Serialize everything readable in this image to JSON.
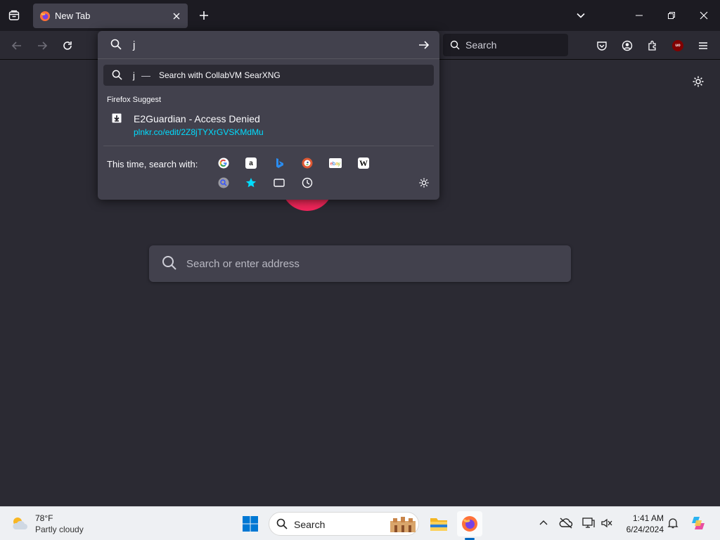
{
  "browser": {
    "tab": {
      "title": "New Tab"
    },
    "searchbar": {
      "placeholder": "Search"
    }
  },
  "urlbar": {
    "input_value": "j",
    "suggestion": {
      "query": "j",
      "dash": "—",
      "engine_text": "Search with CollabVM SearXNG"
    },
    "group_label": "Firefox Suggest",
    "result": {
      "title": "E2Guardian - Access Denied",
      "url": "plnkr.co/edit/2Z8jTYXrGVSKMdMu"
    },
    "oneoff_label": "This time, search with:",
    "engines": [
      "google-icon",
      "amazon-icon",
      "bing-icon",
      "duckduckgo-icon",
      "ebay-icon",
      "wikipedia-icon"
    ],
    "modes": [
      "searxng-icon",
      "bookmarks-icon",
      "tabs-icon",
      "history-icon"
    ]
  },
  "newtab": {
    "search_placeholder": "Search or enter address"
  },
  "taskbar": {
    "weather_temp": "78°F",
    "weather_condition": "Partly cloudy",
    "search_label": "Search",
    "time": "1:41 AM",
    "date": "6/24/2024"
  },
  "colors": {
    "accent": "#00ddff",
    "background": "#2b2a33",
    "panel": "#42414d"
  }
}
